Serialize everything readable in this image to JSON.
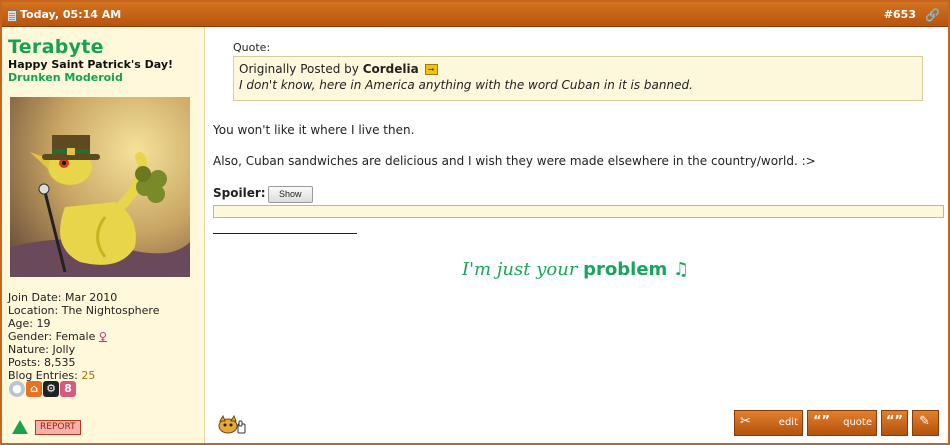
{
  "header": {
    "date": "Today, 05:14 AM",
    "post_number": "#653",
    "icons": {
      "doc": "document-icon",
      "link": "link-icon"
    },
    "colors": {
      "bar": "#c5651f"
    }
  },
  "user": {
    "name": "Terabyte",
    "title": "Happy Saint Patrick's Day!",
    "rank": "Drunken Moderoid",
    "avatar": "leprechaun-pokemon-avatar",
    "colors": {
      "name": "#14a352"
    },
    "info": {
      "join_label": "Join Date:",
      "join_value": "Mar 2010",
      "location_label": "Location:",
      "location_value": "The Nightosphere",
      "age_label": "Age:",
      "age_value": "19",
      "gender_label": "Gender:",
      "gender_value": "Female",
      "gender_symbol": "♀",
      "nature_label": "Nature:",
      "nature_value": "Jolly",
      "posts_label": "Posts:",
      "posts_value": "8,535",
      "blog_label": "Blog Entries:",
      "blog_value": "25"
    },
    "contact_icons": [
      "messenger-icon",
      "homepage-icon",
      "steam-icon",
      "other-icon"
    ],
    "report_label": "REPORT"
  },
  "post": {
    "quote_label": "Quote:",
    "quote_author_prefix": "Originally Posted by",
    "quote_author": "Cordelia",
    "quote_text": "I don't know, here in America anything with the word Cuban in it is banned.",
    "paragraph1": "You won't like it where I live then.",
    "paragraph2": "Also, Cuban sandwiches are delicious and I wish they were made elsewhere in the country/world. :>",
    "spoiler_label": "Spoiler",
    "spoiler_button": "Show",
    "signature_main": "I'm just your",
    "signature_strong": "problem",
    "signature_note": "♫"
  },
  "buttons": {
    "edit": "edit",
    "quote": "quote"
  }
}
